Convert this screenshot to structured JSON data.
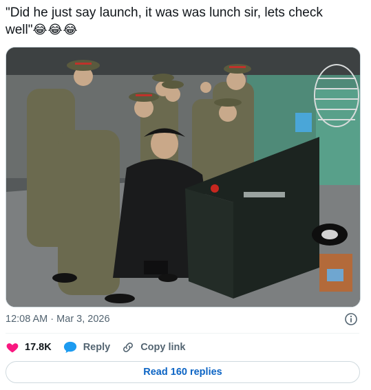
{
  "tweet": {
    "text": "\"Did he just say launch, it was was lunch sir, lets check well\"",
    "emojis": "😂😂😂"
  },
  "meta": {
    "time": "12:08 AM",
    "separator": "·",
    "date": "Mar 3, 2026"
  },
  "actions": {
    "likes_count": "17.8K",
    "reply_label": "Reply",
    "copy_link_label": "Copy link"
  },
  "read_replies": "Read 160 replies",
  "colors": {
    "heart": "#f91880",
    "reply_bubble": "#1d9bf0",
    "link": "#0c64c4",
    "muted": "#536471"
  }
}
